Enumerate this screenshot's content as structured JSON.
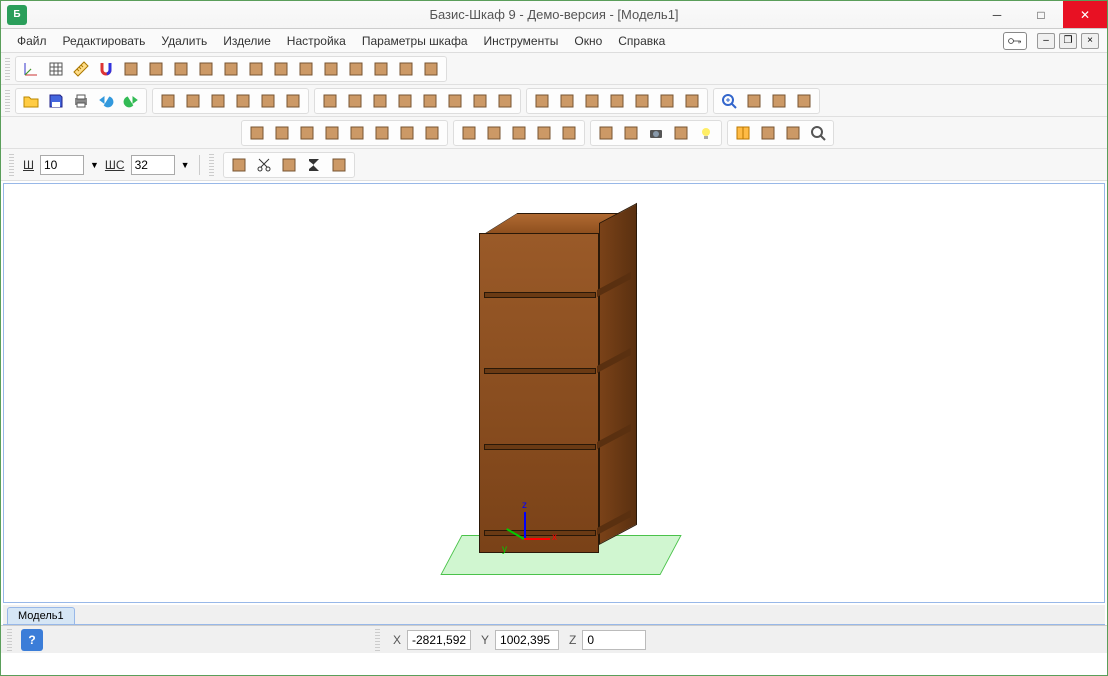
{
  "title": "Базис-Шкаф 9 - Демо-версия - [Модель1]",
  "menu": [
    "Файл",
    "Редактировать",
    "Удалить",
    "Изделие",
    "Настройка",
    "Параметры шкафа",
    "Инструменты",
    "Окно",
    "Справка"
  ],
  "params": {
    "w_label": "Ш",
    "w_value": "10",
    "ws_label": "ШС",
    "ws_value": "32"
  },
  "doc_tab": "Модель1",
  "status": {
    "x_label": "X",
    "x_value": "-2821,592",
    "y_label": "Y",
    "y_value": "1002,395",
    "z_label": "Z",
    "z_value": "0"
  },
  "toolbars": {
    "row1_icons": [
      "axes-icon",
      "grid-icon",
      "ruler-icon",
      "magnet-icon",
      "snap1-icon",
      "snap2-icon",
      "snap3-icon",
      "line1-icon",
      "line2-icon",
      "line3-icon",
      "parallel-icon",
      "delx-icon",
      "dely-icon",
      "square-icon",
      "panel1-icon",
      "mirror-icon",
      "flip-icon"
    ],
    "row2a_icons": [
      "open-icon",
      "save-icon",
      "print-icon",
      "undo-icon",
      "redo-icon"
    ],
    "row2b_icons": [
      "box1-icon",
      "box2-icon",
      "box3-icon",
      "box4-icon",
      "box5-icon",
      "box6-icon"
    ],
    "row2c_icons": [
      "door1-icon",
      "door2-icon",
      "door3-icon",
      "door4-icon",
      "door5-icon",
      "hinge-icon",
      "wheel-icon",
      "panel-icon"
    ],
    "row2d_icons": [
      "group-icon",
      "ungroup-icon",
      "spring1-icon",
      "spring2-icon",
      "spring3-icon",
      "spring4-icon",
      "list-icon"
    ],
    "row2e_icons": [
      "zoom-icon",
      "fit-icon",
      "window-icon",
      "size-icon"
    ],
    "row3a_icons": [
      "cube1",
      "cube2",
      "cube3",
      "cube4",
      "cube5",
      "refresh-icon",
      "move-icon",
      "rotate-icon"
    ],
    "row3b_icons": [
      "tex1",
      "tex2",
      "wire1",
      "wire2",
      "wire3"
    ],
    "row3c_icons": [
      "grid2",
      "view1",
      "camera-icon",
      "folder2-icon",
      "bulb-icon"
    ],
    "row3d_icons": [
      "book-icon",
      "catalog-icon",
      "calc-icon",
      "search-icon"
    ],
    "paramrow_icons": [
      "logo-icon",
      "cut-icon",
      "link-icon",
      "sigma-icon",
      "people-icon"
    ]
  }
}
